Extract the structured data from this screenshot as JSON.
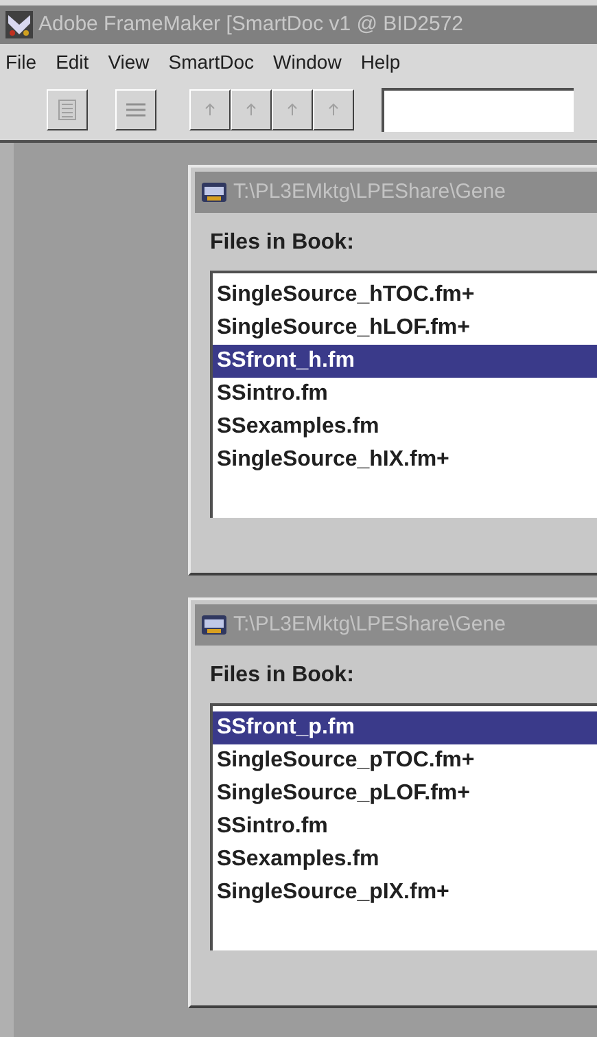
{
  "window": {
    "title": "Adobe FrameMaker [SmartDoc v1 @ BID2572",
    "active": false
  },
  "menu": [
    "File",
    "Edit",
    "View",
    "SmartDoc",
    "Window",
    "Help"
  ],
  "toolbar": {
    "buttons": [
      {
        "kind": "list"
      },
      {
        "kind": "lines"
      },
      {
        "kind": "up"
      },
      {
        "kind": "up"
      },
      {
        "kind": "up"
      },
      {
        "kind": "up"
      }
    ]
  },
  "books": [
    {
      "title": "T:\\PL3EMktg\\LPEShare\\Gene",
      "label": "Files in Book:",
      "files": [
        {
          "name": "SingleSource_hTOC.fm+",
          "selected": false
        },
        {
          "name": "SingleSource_hLOF.fm+",
          "selected": false
        },
        {
          "name": "SSfront_h.fm",
          "selected": true
        },
        {
          "name": "SSintro.fm",
          "selected": false
        },
        {
          "name": "SSexamples.fm",
          "selected": false
        },
        {
          "name": "SingleSource_hIX.fm+",
          "selected": false
        }
      ]
    },
    {
      "title": "T:\\PL3EMktg\\LPEShare\\Gene",
      "label": "Files in Book:",
      "files": [
        {
          "name": "SSfront_p.fm",
          "selected": true
        },
        {
          "name": "SingleSource_pTOC.fm+",
          "selected": false
        },
        {
          "name": "SingleSource_pLOF.fm+",
          "selected": false
        },
        {
          "name": "SSintro.fm",
          "selected": false
        },
        {
          "name": "SSexamples.fm",
          "selected": false
        },
        {
          "name": "SingleSource_pIX.fm+",
          "selected": false
        }
      ]
    }
  ]
}
